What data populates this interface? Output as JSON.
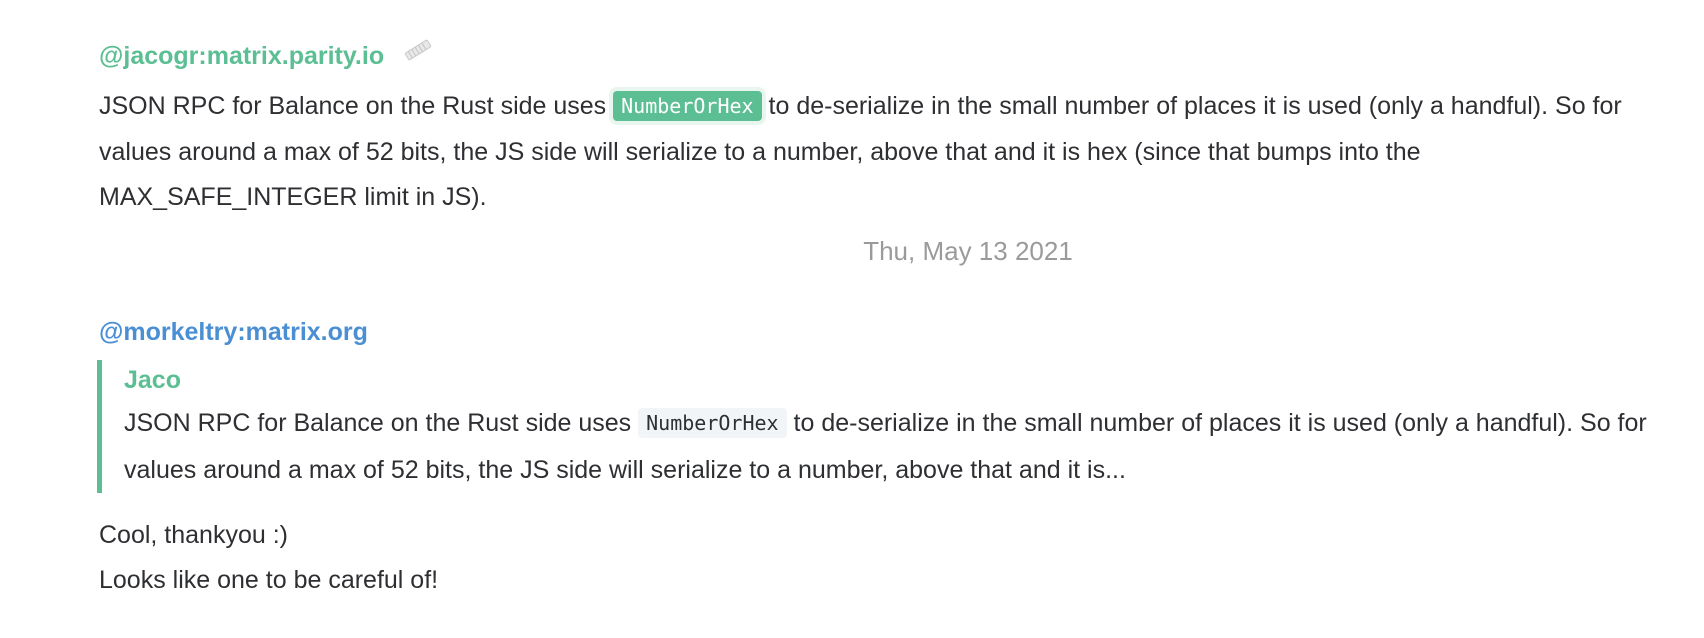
{
  "messages": [
    {
      "sender": "@jacogr:matrix.parity.io",
      "sender_color": "#5cbf93",
      "edit_icon": "pencil-edit-icon",
      "text_before_code": "JSON RPC for Balance on the Rust side uses ",
      "code": "NumberOrHex",
      "text_after_code": " to de-serialize in the small number of places it is used (only a handful). So for values around a max of 52 bits, the JS side will serialize to a number, above that and it is hex (since that bumps into the MAX_SAFE_INTEGER limit in JS)."
    },
    {
      "sender": "@morkeltry:matrix.org",
      "sender_color": "#4a8fd4",
      "quote": {
        "sender": "Jaco",
        "sender_color": "#5cbf93",
        "text_before_code": "JSON RPC for Balance on the Rust side uses ",
        "code": "NumberOrHex",
        "text_after_code": " to de-serialize in the small number of places it is used (only a handful). So for values around a max of 52 bits, the JS side will serialize to a number, above that and it is..."
      },
      "lines": [
        "Cool, thankyou :)",
        "Looks like one to be careful of!"
      ]
    }
  ],
  "date_separator": "Thu, May 13 2021"
}
